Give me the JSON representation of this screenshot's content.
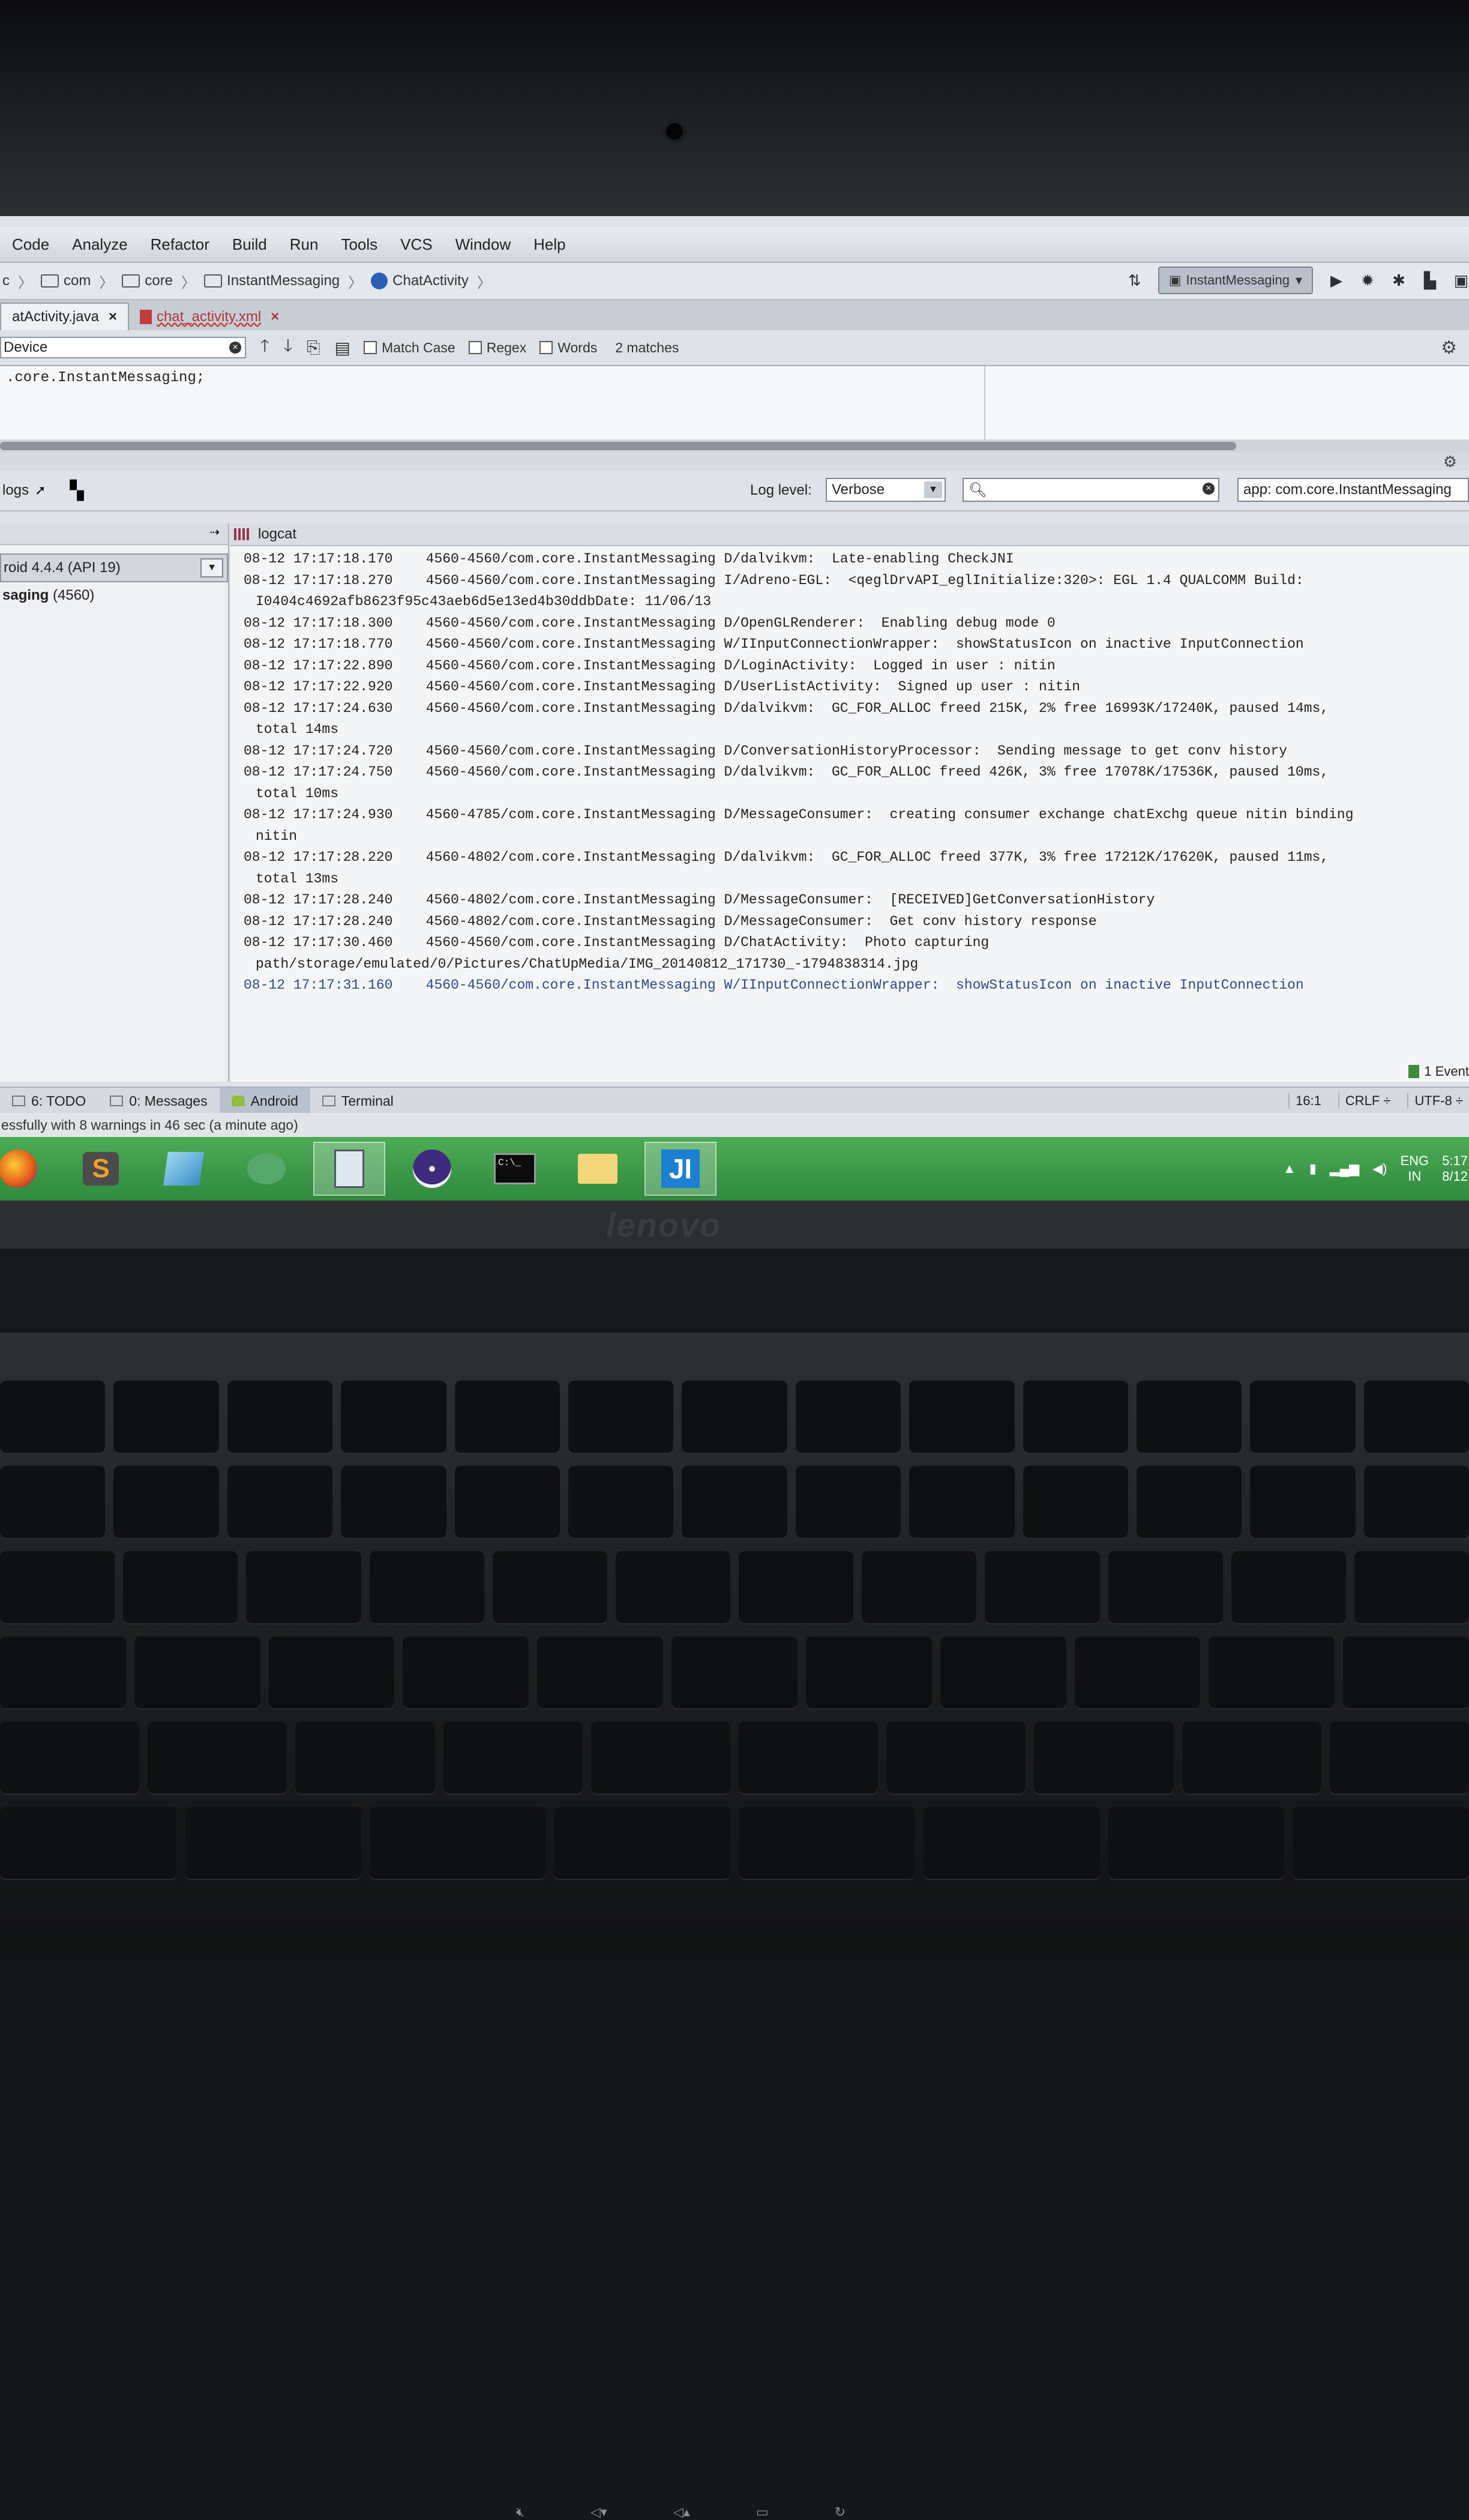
{
  "menu": [
    "Code",
    "Analyze",
    "Refactor",
    "Build",
    "Run",
    "Tools",
    "VCS",
    "Window",
    "Help"
  ],
  "breadcrumbs": [
    "c",
    "com",
    "core",
    "InstantMessaging",
    "ChatActivity"
  ],
  "run_config": "InstantMessaging",
  "editor_tabs": [
    {
      "label": "atActivity.java",
      "close": "×"
    },
    {
      "label": "chat_activity.xml",
      "close": "×"
    }
  ],
  "find": {
    "value": "Device",
    "match_case": "Match Case",
    "regex": "Regex",
    "words": "Words",
    "matches": "2 matches"
  },
  "code_line": ".core.InstantMessaging;",
  "logcat_bar": {
    "logs_label": "logs",
    "log_level_label": "Log level:",
    "log_level_value": "Verbose",
    "search_value": "",
    "app_filter": "app: com.core.InstantMessaging"
  },
  "devices": {
    "device": "roid 4.4.4 (API 19)",
    "process_name": "saging",
    "process_pid": "(4560)"
  },
  "logcat": {
    "title": "logcat",
    "lines": [
      {
        "text": "08-12 17:17:18.170    4560-4560/com.core.InstantMessaging D/dalvikvm:  Late-enabling CheckJNI",
        "cont": "",
        "warn": false
      },
      {
        "text": "08-12 17:17:18.270    4560-4560/com.core.InstantMessaging I/Adreno-EGL:  <qeglDrvAPI_eglInitialize:320>: EGL 1.4 QUALCOMM Build:",
        "cont": "I0404c4692afb8623f95c43aeb6d5e13ed4b30ddbDate: 11/06/13",
        "warn": false
      },
      {
        "text": "08-12 17:17:18.300    4560-4560/com.core.InstantMessaging D/OpenGLRenderer:  Enabling debug mode 0",
        "cont": "",
        "warn": false
      },
      {
        "text": "08-12 17:17:18.770    4560-4560/com.core.InstantMessaging W/IInputConnectionWrapper:  showStatusIcon on inactive InputConnection",
        "cont": "",
        "warn": false
      },
      {
        "text": "08-12 17:17:22.890    4560-4560/com.core.InstantMessaging D/LoginActivity:  Logged in user : nitin",
        "cont": "",
        "warn": false
      },
      {
        "text": "08-12 17:17:22.920    4560-4560/com.core.InstantMessaging D/UserListActivity:  Signed up user : nitin",
        "cont": "",
        "warn": false
      },
      {
        "text": "08-12 17:17:24.630    4560-4560/com.core.InstantMessaging D/dalvikvm:  GC_FOR_ALLOC freed 215K, 2% free 16993K/17240K, paused 14ms,",
        "cont": "total 14ms",
        "warn": false
      },
      {
        "text": "08-12 17:17:24.720    4560-4560/com.core.InstantMessaging D/ConversationHistoryProcessor:  Sending message to get conv history",
        "cont": "",
        "warn": false
      },
      {
        "text": "08-12 17:17:24.750    4560-4560/com.core.InstantMessaging D/dalvikvm:  GC_FOR_ALLOC freed 426K, 3% free 17078K/17536K, paused 10ms,",
        "cont": "total 10ms",
        "warn": false
      },
      {
        "text": "08-12 17:17:24.930    4560-4785/com.core.InstantMessaging D/MessageConsumer:  creating consumer exchange chatExchg queue nitin binding",
        "cont": "nitin",
        "warn": false
      },
      {
        "text": "08-12 17:17:28.220    4560-4802/com.core.InstantMessaging D/dalvikvm:  GC_FOR_ALLOC freed 377K, 3% free 17212K/17620K, paused 11ms,",
        "cont": "total 13ms",
        "warn": false
      },
      {
        "text": "08-12 17:17:28.240    4560-4802/com.core.InstantMessaging D/MessageConsumer:  [RECEIVED]GetConversationHistory",
        "cont": "",
        "warn": false
      },
      {
        "text": "08-12 17:17:28.240    4560-4802/com.core.InstantMessaging D/MessageConsumer:  Get conv history response",
        "cont": "",
        "warn": false
      },
      {
        "text": "08-12 17:17:30.460    4560-4560/com.core.InstantMessaging D/ChatActivity:  Photo capturing",
        "cont": "path/storage/emulated/0/Pictures/ChatUpMedia/IMG_20140812_171730_-1794838314.jpg",
        "warn": false
      },
      {
        "text": "08-12 17:17:31.160    4560-4560/com.core.InstantMessaging W/IInputConnectionWrapper:  showStatusIcon on inactive InputConnection",
        "cont": "",
        "warn": true
      }
    ]
  },
  "tool_windows": [
    {
      "label": "6: TODO",
      "active": false,
      "kind": "todo"
    },
    {
      "label": "0: Messages",
      "active": false,
      "kind": "messages"
    },
    {
      "label": "Android",
      "active": true,
      "kind": "android"
    },
    {
      "label": "Terminal",
      "active": false,
      "kind": "terminal"
    }
  ],
  "event_log": "1 Event",
  "status": {
    "message": "essfully with 8 warnings in 46 sec (a minute ago)",
    "position": "16:1",
    "line_sep": "CRLF ÷",
    "encoding": "UTF-8 ÷"
  },
  "taskbar": {
    "apps": [
      "firefox-icon",
      "sublime-icon",
      "notepad-icon",
      "gecko-icon",
      "installer-icon",
      "eclipse-icon",
      "cmd-icon",
      "explorer-icon",
      "intellij-icon"
    ],
    "lang": "ENG",
    "region": "IN",
    "time": "5:17",
    "date": "8/12"
  },
  "laptop_brand": "lenovo",
  "colors": {
    "taskbar": "#2f8a3e",
    "ide_bg": "#dfe3e8",
    "warn_text": "#2c4a88"
  }
}
